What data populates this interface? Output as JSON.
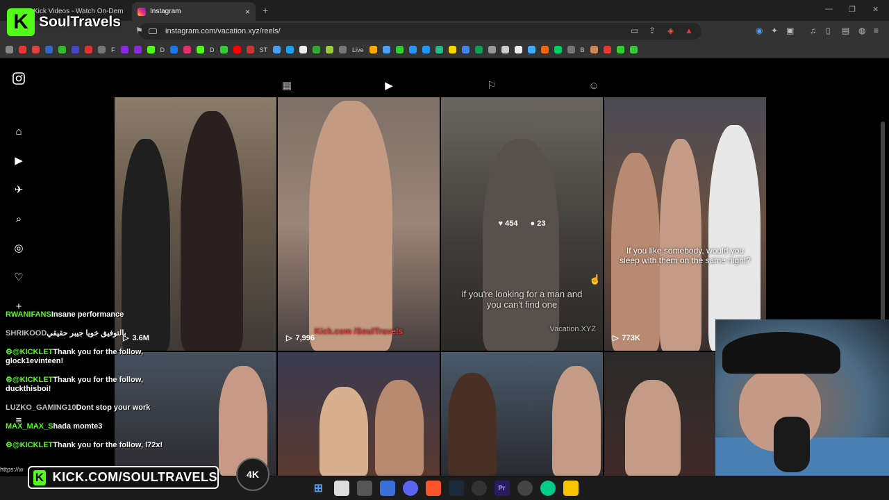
{
  "browser": {
    "inactive_tab_title": "Kick Videos - Watch On-Dem",
    "active_tab_title": "Instagram",
    "close_glyph": "×",
    "new_tab_glyph": "+",
    "url": "instagram.com/vacation.xyz/reels/",
    "bookmark_labels": [
      "F",
      "D",
      "D",
      "ST",
      "Live",
      "B"
    ]
  },
  "overlay": {
    "streamer_name": "SoulTravels",
    "k_letter": "K",
    "kick_url": "KICK.COM/SOULTRAVELS",
    "emblem_text": "4K"
  },
  "instagram": {
    "tiles": [
      {
        "views": "3.6M",
        "caption": ""
      },
      {
        "views": "7,996",
        "caption": "Kick.com /SoulTravels"
      },
      {
        "likes": "454",
        "comments": "23",
        "caption": "if you're looking for a man and you can't find one",
        "watermark": "Vacation.XYZ"
      },
      {
        "views": "773K",
        "caption": "If you like somebody, would you sleep with them on the same night?"
      }
    ]
  },
  "chat": [
    {
      "user": "RWANIFANS",
      "msg": "Insane performance"
    },
    {
      "user": "SHRIKOOD",
      "msg": "بالتوفيق خويا جيبر حقيقي"
    },
    {
      "user": "@KICKLET",
      "msg": "Thank you for the follow, glock1evinteen!"
    },
    {
      "user": "@KICKLET",
      "msg": "Thank you for the follow, duckthisboi!"
    },
    {
      "user": "LUZKO_GAMING10",
      "msg": "Dont stop your work"
    },
    {
      "user": "MAX_MAX_S",
      "msg": "hada momte3"
    },
    {
      "user": "@KICKLET",
      "msg": "Thank you for the follow, l72x!"
    }
  ],
  "status_url": "https://w",
  "taskbar": {
    "premiere_label": "Pr"
  },
  "colors": {
    "kick_green": "#53fc18",
    "browser_bg": "#333333",
    "page_bg": "#000000"
  }
}
